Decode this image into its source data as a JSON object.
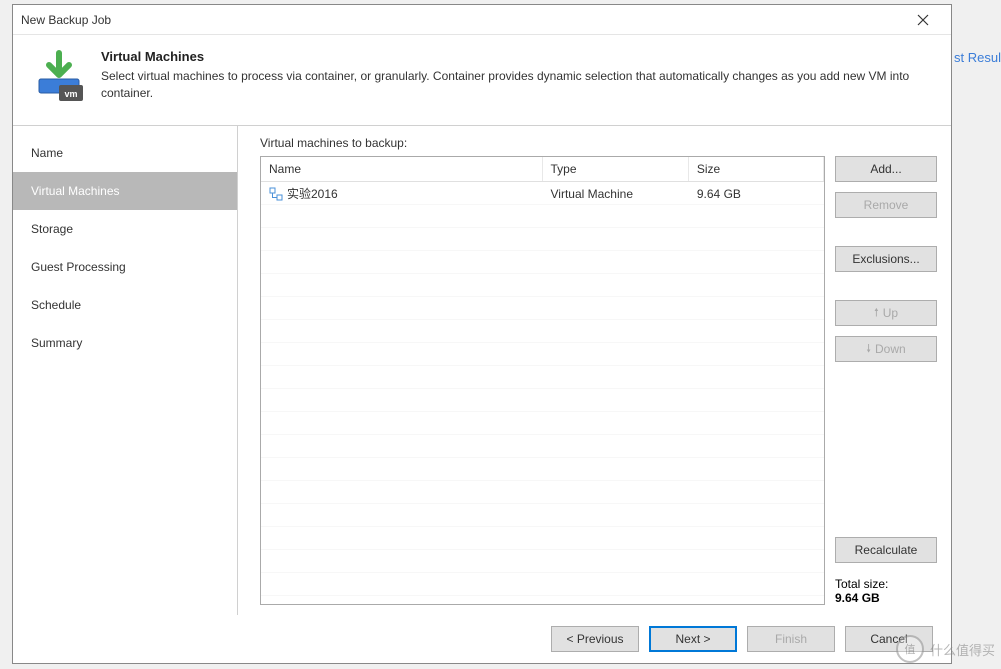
{
  "bg_text": "st Resul",
  "dialog": {
    "title": "New Backup Job",
    "header": {
      "heading": "Virtual Machines",
      "description": "Select virtual machines to process via container, or granularly. Container provides dynamic selection that automatically changes as you add new VM into container."
    }
  },
  "sidebar": {
    "items": [
      {
        "label": "Name",
        "selected": false
      },
      {
        "label": "Virtual Machines",
        "selected": true
      },
      {
        "label": "Storage",
        "selected": false
      },
      {
        "label": "Guest Processing",
        "selected": false
      },
      {
        "label": "Schedule",
        "selected": false
      },
      {
        "label": "Summary",
        "selected": false
      }
    ]
  },
  "main": {
    "label": "Virtual machines to backup:",
    "columns": {
      "name": "Name",
      "type": "Type",
      "size": "Size"
    },
    "rows": [
      {
        "name": "实验2016",
        "type": "Virtual Machine",
        "size": "9.64 GB"
      }
    ],
    "total_label": "Total size:",
    "total_value": "9.64 GB"
  },
  "buttons": {
    "add": "Add...",
    "remove": "Remove",
    "exclusions": "Exclusions...",
    "up": "Up",
    "down": "Down",
    "recalculate": "Recalculate"
  },
  "footer": {
    "previous": "< Previous",
    "next": "Next >",
    "finish": "Finish",
    "cancel": "Cancel"
  },
  "watermark": {
    "circle": "值",
    "text": "什么值得买"
  }
}
